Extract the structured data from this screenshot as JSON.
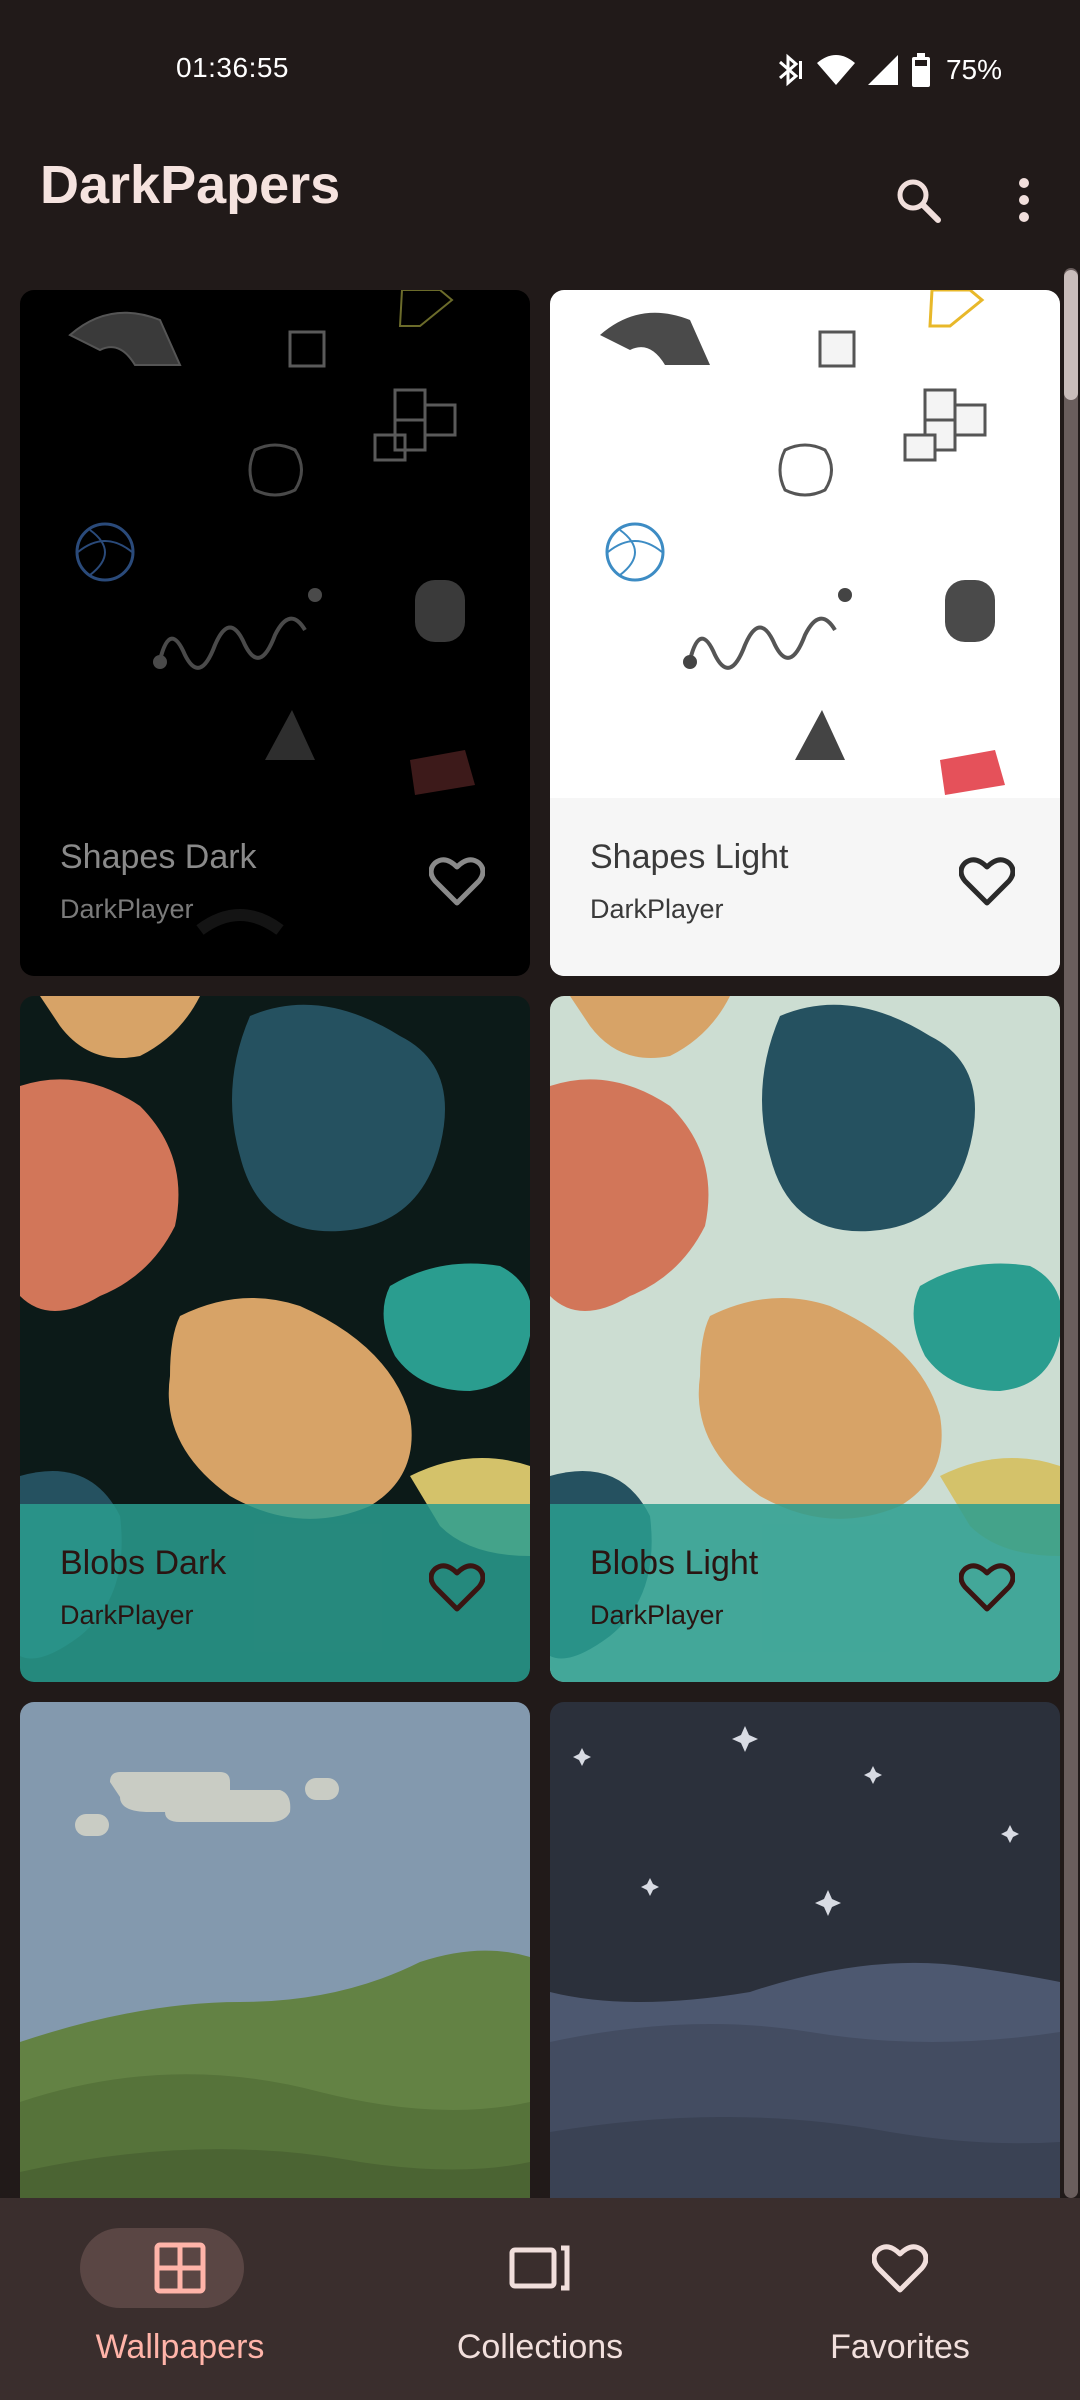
{
  "status_bar": {
    "time": "01:36:55",
    "battery": "75%",
    "icons": [
      "bluetooth-icon",
      "wifi-icon",
      "signal-icon",
      "battery-icon"
    ]
  },
  "app_bar": {
    "title": "DarkPapers",
    "actions": [
      "search-icon",
      "more-vert-icon"
    ]
  },
  "wallpapers": [
    {
      "title": "Shapes Dark",
      "author": "DarkPlayer",
      "theme": "shapes-dark"
    },
    {
      "title": "Shapes Light",
      "author": "DarkPlayer",
      "theme": "shapes-light"
    },
    {
      "title": "Blobs Dark",
      "author": "DarkPlayer",
      "theme": "blobs-dark"
    },
    {
      "title": "Blobs Light",
      "author": "DarkPlayer",
      "theme": "blobs-light"
    },
    {
      "title": "",
      "author": "",
      "theme": "hills-day"
    },
    {
      "title": "",
      "author": "",
      "theme": "hills-night"
    }
  ],
  "bottom_nav": {
    "items": [
      {
        "label": "Wallpapers",
        "icon": "grid-icon",
        "selected": true
      },
      {
        "label": "Collections",
        "icon": "collections-icon",
        "selected": false
      },
      {
        "label": "Favorites",
        "icon": "heart-icon",
        "selected": false
      }
    ]
  },
  "colors": {
    "background": "#211a19",
    "nav_background": "#3a2e2d",
    "accent": "#ffb4a9",
    "blob_teal": "#2a9d8f",
    "blob_orange": "#d27659",
    "blob_sand": "#d7a367",
    "blob_slate": "#255160"
  }
}
